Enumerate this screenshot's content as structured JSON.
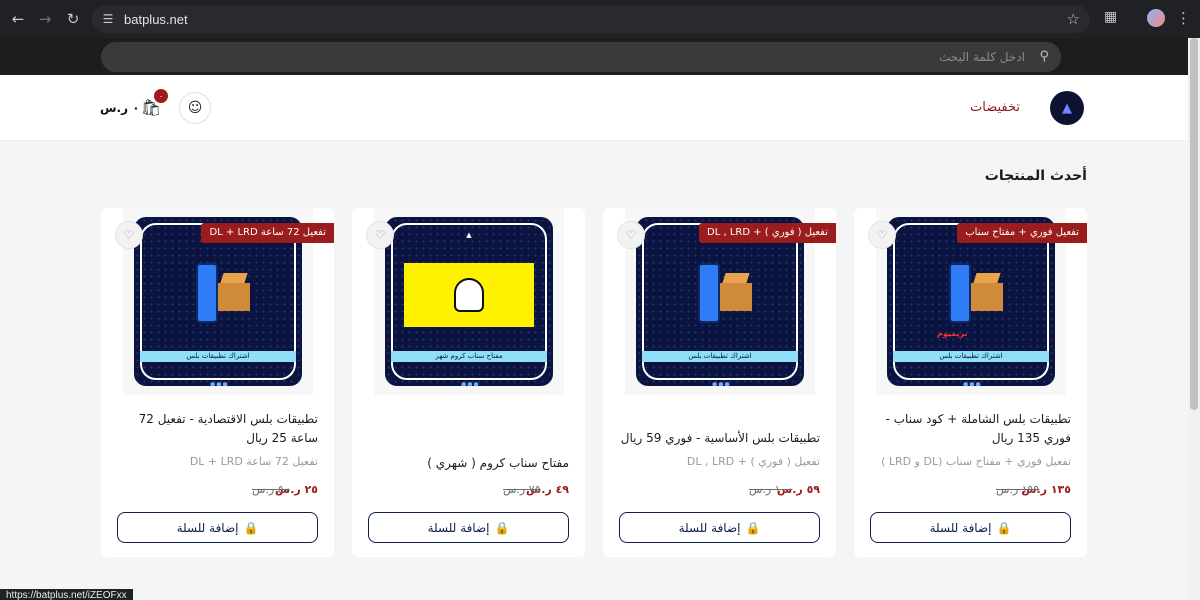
{
  "browser": {
    "url": "batplus.net",
    "status_url": "https://batplus.net/iZEOFxx",
    "icons": [
      "back-icon",
      "forward-icon",
      "reload-icon",
      "site-settings-icon",
      "star-icon",
      "extensions-icon",
      "profile-avatar",
      "menu-icon"
    ]
  },
  "site": {
    "search_placeholder": "ادخل كلمة البحث",
    "nav_link": "تخفيضات",
    "cart_badge": "٠",
    "cart_total": "٠ ر.س",
    "section_title": "أحدث المنتجات",
    "add_to_cart": "إضافة للسلة"
  },
  "colors": {
    "accent": "#9b1c1c",
    "primary": "#0f1e4a"
  },
  "products": [
    {
      "ribbon": "تفعيل فوري + مفتاح سناب",
      "image_strip": "اشتراك تطبيقات بلس",
      "image_extra": "بريميوم",
      "name": "تطبيقات بلس الشاملة + كود سناب - فوري 135 ريال",
      "subtitle": "تفعيل فوري + مفتاح سناب (DL و LRD )",
      "price": "١٣٥ ر.س",
      "old_price": "١٩٩ ر.س"
    },
    {
      "ribbon": "تفعيل ( فوري ) + DL , LRD",
      "image_strip": "اشتراك تطبيقات بلس",
      "image_extra": "",
      "name": "تطبيقات بلس الأساسية - فوري 59 ريال",
      "subtitle": "تفعيل ( فوري ) + DL , LRD",
      "price": "٥٩ ر.س",
      "old_price": "١٠٠ ر.س"
    },
    {
      "ribbon": "",
      "image_strip": "مفتاح سناب كروم شهر",
      "image_extra": "",
      "name": "مفتاح سناب كروم ( شهري )",
      "subtitle": "",
      "price": "٤٩ ر.س",
      "old_price": "٧٥ ر.س"
    },
    {
      "ribbon": "تفعيل 72 ساعة DL + LRD",
      "image_strip": "اشتراك تطبيقات بلس",
      "image_extra": "",
      "name": "تطبيقات بلس الاقتصادية - تفعيل 72 ساعة 25 ريال",
      "subtitle": "تفعيل 72 ساعة DL + LRD",
      "price": "٢٥ ر.س",
      "old_price": "٥٠ ر.س"
    }
  ]
}
